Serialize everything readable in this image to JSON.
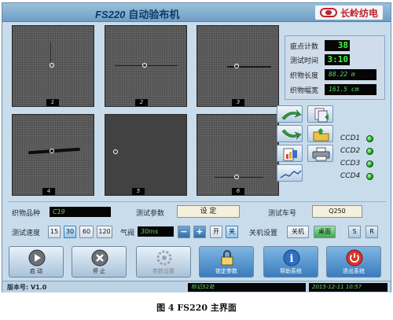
{
  "window": {
    "title_prefix": "FS220",
    "title_suffix": "自动验布机",
    "brand": "长岭纺电"
  },
  "cameras": [
    {
      "label": "1"
    },
    {
      "label": "2"
    },
    {
      "label": "3"
    },
    {
      "label": "4"
    },
    {
      "label": "5"
    },
    {
      "label": "6"
    }
  ],
  "stats": {
    "defect_count_label": "疵点计数",
    "defect_count_value": "38",
    "test_time_label": "测试时间",
    "test_time_value": "3:10",
    "fabric_length_label": "织物长度",
    "fabric_length_value": "88.22 m",
    "fabric_width_label": "织物幅宽",
    "fabric_width_value": "161.5 cm"
  },
  "toolbar": {
    "icons": [
      "arrow-up-icon",
      "copy-icon",
      "arrow-down-icon",
      "folder-open-icon",
      "report-icon",
      "printer-icon",
      "trend-chart-icon"
    ]
  },
  "ccd": [
    {
      "label": "CCD1",
      "color": "#1fa81f"
    },
    {
      "label": "CCD2",
      "color": "#1fa81f"
    },
    {
      "label": "CCD3",
      "color": "#1fa81f"
    },
    {
      "label": "CCD4",
      "color": "#1fa81f"
    }
  ],
  "controls": {
    "fabric_type_label": "织物品种",
    "fabric_type_value": "C19",
    "test_params_label": "测试参数",
    "set_button": "设 定",
    "test_car_label": "测试车号",
    "test_car_value": "Q250",
    "speed_label": "测试速度",
    "speeds": [
      "15",
      "30",
      "60",
      "120"
    ],
    "selected_speed": "30",
    "air_valve_label": "气阀",
    "air_valve_value": "30ms",
    "minus": "−",
    "plus": "+",
    "on_label": "开",
    "off_label": "关",
    "shutdown_label": "关机设置",
    "shutdown_btn": "关机",
    "desktop_btn": "桌面",
    "s_btn": "S",
    "r_btn": "R"
  },
  "actions": [
    {
      "label": "启 动"
    },
    {
      "label": "停 止"
    },
    {
      "label": "参数设置"
    },
    {
      "label": "锁定参数"
    },
    {
      "label": "帮助系统"
    },
    {
      "label": "退出系统"
    }
  ],
  "status": {
    "version": "版本号: V1.0",
    "mark": "标记32处",
    "datetime": "2015-12-11  10:57"
  },
  "caption": "图 4   FS220 主界面"
}
